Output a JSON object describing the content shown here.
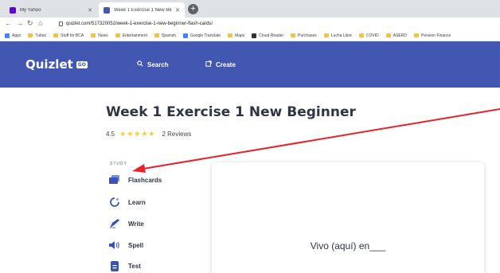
{
  "browser": {
    "tabs": [
      {
        "label": "My Yahoo",
        "favicon_color": "#6001d2",
        "active": false
      },
      {
        "label": "Week 1 Exercise 1 New Beginner",
        "favicon_color": "#4257b2",
        "active": true
      }
    ],
    "new_tab_glyph": "+",
    "url": "quizlet.com/517320052/week-1-exercise-1-new-beginner-flash-cards/",
    "bookmarks": [
      {
        "label": "Apps",
        "icon": "apps-icon"
      },
      {
        "label": "Tubac",
        "icon": "folder-icon"
      },
      {
        "label": "Stuff for BCA",
        "icon": "folder-icon"
      },
      {
        "label": "News",
        "icon": "folder-icon"
      },
      {
        "label": "Entertainment",
        "icon": "folder-icon"
      },
      {
        "label": "Spanish",
        "icon": "folder-icon"
      },
      {
        "label": "Google Translate",
        "icon": "google-translate-icon"
      },
      {
        "label": "Maps",
        "icon": "folder-icon"
      },
      {
        "label": "Cloud Reader",
        "icon": "cloud-reader-icon"
      },
      {
        "label": "Purchases",
        "icon": "folder-icon"
      },
      {
        "label": "Lucha Libre",
        "icon": "folder-icon"
      },
      {
        "label": "COVID",
        "icon": "folder-icon"
      },
      {
        "label": "ASERD",
        "icon": "folder-icon"
      },
      {
        "label": "Pension Finance",
        "icon": "folder-icon"
      }
    ]
  },
  "header": {
    "logo": "Quizlet",
    "logo_badge": "GO",
    "search_label": "Search",
    "create_label": "Create",
    "color": "#4257b2"
  },
  "set": {
    "title": "Week 1 Exercise 1 New Beginner",
    "rating_value": "4.5",
    "stars": 4.5,
    "reviews": "2 Reviews"
  },
  "study": {
    "label": "STUDY",
    "items": [
      {
        "label": "Flashcards",
        "icon": "flashcards-icon"
      },
      {
        "label": "Learn",
        "icon": "learn-icon"
      },
      {
        "label": "Write",
        "icon": "write-icon"
      },
      {
        "label": "Spell",
        "icon": "spell-icon"
      },
      {
        "label": "Test",
        "icon": "test-icon"
      }
    ]
  },
  "card": {
    "term": "Vivo (aquí) en___"
  },
  "colors": {
    "annotation_arrow": "#e8212b",
    "star": "#ffcd1f",
    "text": "#303545"
  }
}
